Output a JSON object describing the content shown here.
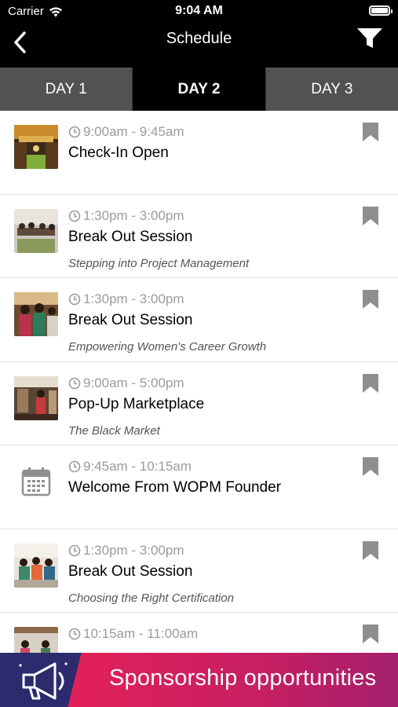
{
  "status_bar": {
    "carrier": "Carrier",
    "time": "9:04 AM",
    "wifi_icon": "wifi-icon",
    "battery_icon": "battery-icon"
  },
  "nav": {
    "title": "Schedule",
    "back_icon": "chevron-left-icon",
    "filter_icon": "filter-icon"
  },
  "tabs": [
    {
      "label": "DAY 1",
      "active": false
    },
    {
      "label": "DAY 2",
      "active": true
    },
    {
      "label": "DAY 3",
      "active": false
    }
  ],
  "sessions": [
    {
      "time": "9:00am - 9:45am",
      "title": "Check-In Open",
      "subtitle": "",
      "thumb": "photo",
      "bookmark_icon": "bookmark-icon"
    },
    {
      "time": "1:30pm - 3:00pm",
      "title": "Break Out Session",
      "subtitle": "Stepping into Project Management",
      "thumb": "photo",
      "bookmark_icon": "bookmark-icon"
    },
    {
      "time": "1:30pm - 3:00pm",
      "title": "Break Out Session",
      "subtitle": "Empowering Women's Career Growth",
      "thumb": "photo",
      "bookmark_icon": "bookmark-icon"
    },
    {
      "time": "9:00am - 5:00pm",
      "title": "Pop-Up Marketplace",
      "subtitle": "The Black Market",
      "thumb": "photo",
      "bookmark_icon": "bookmark-icon"
    },
    {
      "time": "9:45am - 10:15am",
      "title": "Welcome From WOPM Founder",
      "subtitle": "",
      "thumb": "calendar-icon",
      "bookmark_icon": "bookmark-icon"
    },
    {
      "time": "1:30pm - 3:00pm",
      "title": "Break Out Session",
      "subtitle": "Choosing the Right Certification",
      "thumb": "photo",
      "bookmark_icon": "bookmark-icon"
    },
    {
      "time": "10:15am - 11:00am",
      "title": "",
      "subtitle": "",
      "thumb": "photo",
      "bookmark_icon": "bookmark-icon"
    }
  ],
  "banner": {
    "text": "Sponsorship opportunities",
    "icon": "megaphone-icon"
  },
  "colors": {
    "nav_bg": "#000000",
    "tab_inactive": "#525252",
    "tab_active": "#000000",
    "banner_pink": "#e0205a",
    "banner_navy": "#2b2b6e",
    "time_gray": "#9b9b9b"
  }
}
